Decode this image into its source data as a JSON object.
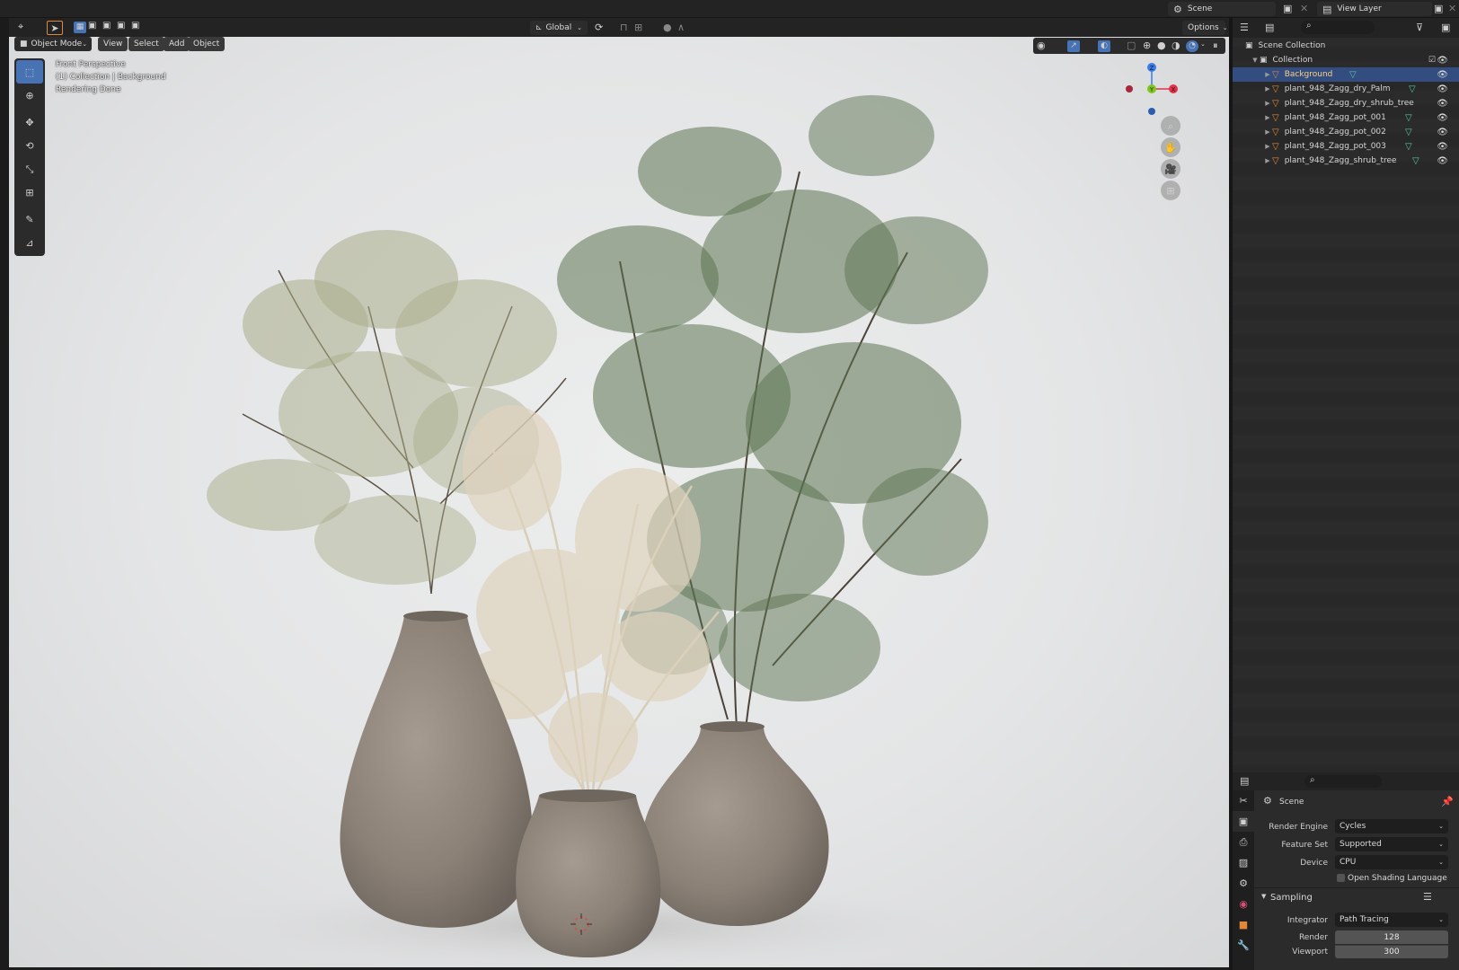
{
  "topbar": {
    "scene_label": "Scene",
    "view_layer_label": "View Layer"
  },
  "viewport_header": {
    "mode": "Object Mode",
    "menus": [
      "View",
      "Select",
      "Add",
      "Object"
    ],
    "orientation": "Global",
    "options": "Options"
  },
  "viewport_overlay": {
    "line1": "Front Perspective",
    "line2": "(1) Collection | Background",
    "line3": "Rendering Done"
  },
  "gizmo": {
    "z": "Z",
    "y": "Y",
    "x": "X"
  },
  "outliner": {
    "root": "Scene Collection",
    "collection": "Collection",
    "items": [
      {
        "label": "Background",
        "selected": true
      },
      {
        "label": "plant_948_Zagg_dry_Palm",
        "selected": false
      },
      {
        "label": "plant_948_Zagg_dry_shrub_tree",
        "selected": false
      },
      {
        "label": "plant_948_Zagg_pot_001",
        "selected": false
      },
      {
        "label": "plant_948_Zagg_pot_002",
        "selected": false
      },
      {
        "label": "plant_948_Zagg_pot_003",
        "selected": false
      },
      {
        "label": "plant_948_Zagg_shrub_tree",
        "selected": false
      }
    ]
  },
  "properties": {
    "context": "Scene",
    "render_engine_label": "Render Engine",
    "render_engine": "Cycles",
    "feature_set_label": "Feature Set",
    "feature_set": "Supported",
    "device_label": "Device",
    "device": "CPU",
    "osl_label": "Open Shading Language",
    "sampling_label": "Sampling",
    "integrator_label": "Integrator",
    "integrator": "Path Tracing",
    "render_label": "Render",
    "render_samples": "128",
    "viewport_label": "Viewport",
    "viewport_samples": "300"
  },
  "colors": {
    "accent": "#4772b3",
    "selection": "#334d80",
    "object_icon": "#e0873a",
    "mesh_icon": "#54c9a3",
    "axis_x": "#e0334a",
    "axis_y": "#7ec61f",
    "axis_z": "#3b7de8"
  }
}
